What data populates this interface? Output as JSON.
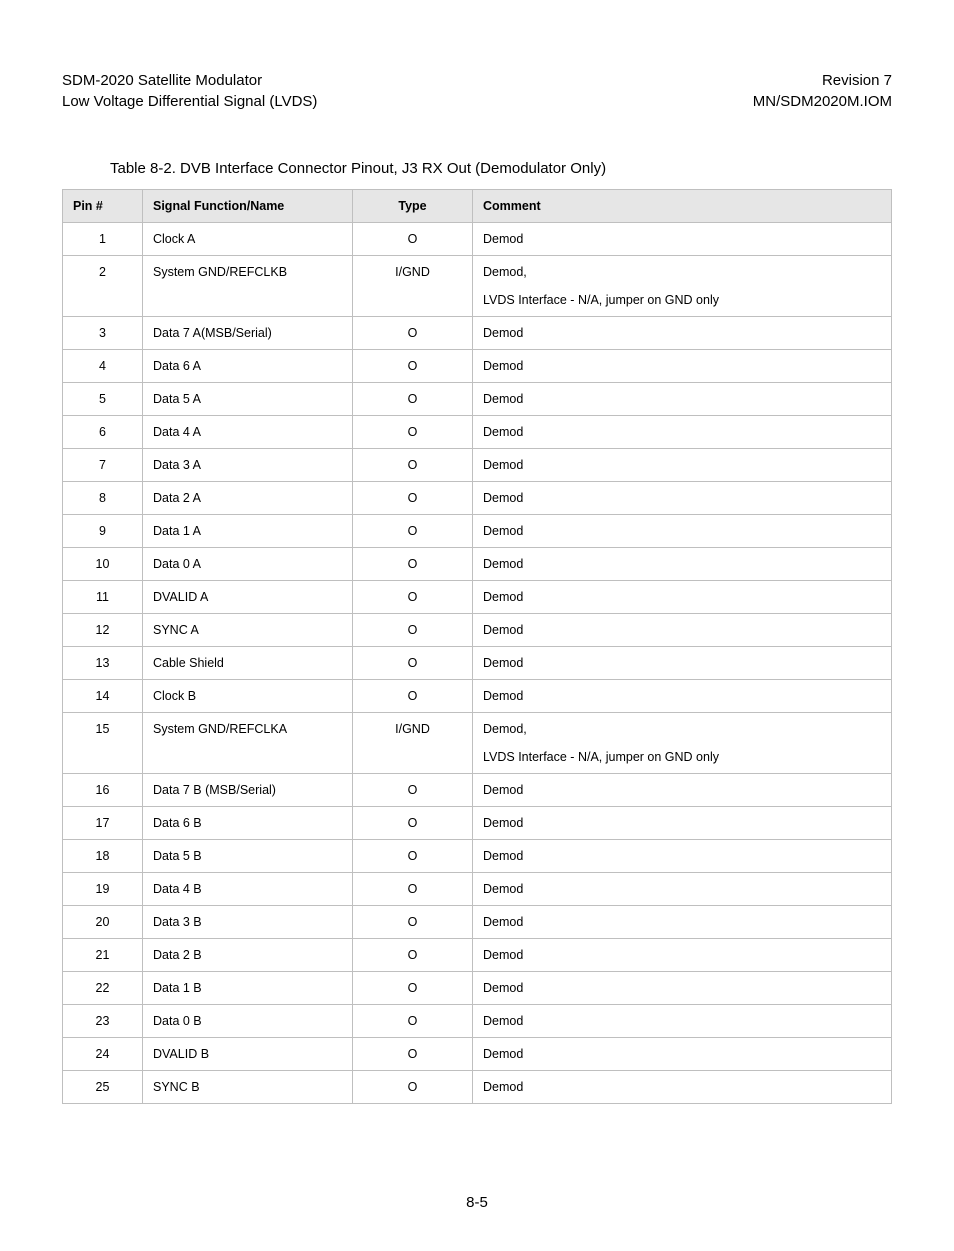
{
  "header": {
    "left1": "SDM-2020 Satellite Modulator",
    "left2": "Low Voltage Differential Signal (LVDS)",
    "right1": "Revision 7",
    "right2": "MN/SDM2020M.IOM"
  },
  "table_title": "Table 8-2.  DVB Interface Connector Pinout, J3 RX Out (Demodulator Only)",
  "columns": {
    "pin": "Pin #",
    "signal": "Signal Function/Name",
    "type": "Type",
    "comment": "Comment"
  },
  "rows": [
    {
      "pin": "1",
      "signal": "Clock A",
      "type": "O",
      "comment": [
        "Demod"
      ]
    },
    {
      "pin": "2",
      "signal": "System GND/REFCLKB",
      "type": "I/GND",
      "comment": [
        "Demod,",
        "LVDS Interface - N/A, jumper on GND only"
      ]
    },
    {
      "pin": "3",
      "signal": "Data 7 A(MSB/Serial)",
      "type": "O",
      "comment": [
        "Demod"
      ]
    },
    {
      "pin": "4",
      "signal": "Data 6 A",
      "type": "O",
      "comment": [
        "Demod"
      ]
    },
    {
      "pin": "5",
      "signal": "Data 5 A",
      "type": "O",
      "comment": [
        "Demod"
      ]
    },
    {
      "pin": "6",
      "signal": "Data 4 A",
      "type": "O",
      "comment": [
        "Demod"
      ]
    },
    {
      "pin": "7",
      "signal": "Data 3 A",
      "type": "O",
      "comment": [
        "Demod"
      ]
    },
    {
      "pin": "8",
      "signal": "Data 2 A",
      "type": "O",
      "comment": [
        "Demod"
      ]
    },
    {
      "pin": "9",
      "signal": "Data 1 A",
      "type": "O",
      "comment": [
        "Demod"
      ]
    },
    {
      "pin": "10",
      "signal": "Data 0 A",
      "type": "O",
      "comment": [
        "Demod"
      ]
    },
    {
      "pin": "11",
      "signal": "DVALID A",
      "type": "O",
      "comment": [
        "Demod"
      ]
    },
    {
      "pin": "12",
      "signal": "SYNC A",
      "type": "O",
      "comment": [
        "Demod"
      ]
    },
    {
      "pin": "13",
      "signal": "Cable Shield",
      "type": "O",
      "comment": [
        "Demod"
      ]
    },
    {
      "pin": "14",
      "signal": "Clock B",
      "type": "O",
      "comment": [
        "Demod"
      ]
    },
    {
      "pin": "15",
      "signal": "System GND/REFCLKA",
      "type": "I/GND",
      "comment": [
        "Demod,",
        "LVDS Interface - N/A, jumper on GND only"
      ]
    },
    {
      "pin": "16",
      "signal": "Data 7 B (MSB/Serial)",
      "type": "O",
      "comment": [
        "Demod"
      ]
    },
    {
      "pin": "17",
      "signal": "Data 6 B",
      "type": "O",
      "comment": [
        "Demod"
      ]
    },
    {
      "pin": "18",
      "signal": "Data 5 B",
      "type": "O",
      "comment": [
        "Demod"
      ]
    },
    {
      "pin": "19",
      "signal": "Data 4 B",
      "type": "O",
      "comment": [
        "Demod"
      ]
    },
    {
      "pin": "20",
      "signal": "Data 3 B",
      "type": "O",
      "comment": [
        "Demod"
      ]
    },
    {
      "pin": "21",
      "signal": "Data 2 B",
      "type": "O",
      "comment": [
        "Demod"
      ]
    },
    {
      "pin": "22",
      "signal": "Data 1 B",
      "type": "O",
      "comment": [
        "Demod"
      ]
    },
    {
      "pin": "23",
      "signal": "Data 0 B",
      "type": "O",
      "comment": [
        "Demod"
      ]
    },
    {
      "pin": "24",
      "signal": "DVALID B",
      "type": "O",
      "comment": [
        "Demod"
      ]
    },
    {
      "pin": "25",
      "signal": "SYNC B",
      "type": "O",
      "comment": [
        "Demod"
      ]
    }
  ],
  "page_number": "8-5"
}
